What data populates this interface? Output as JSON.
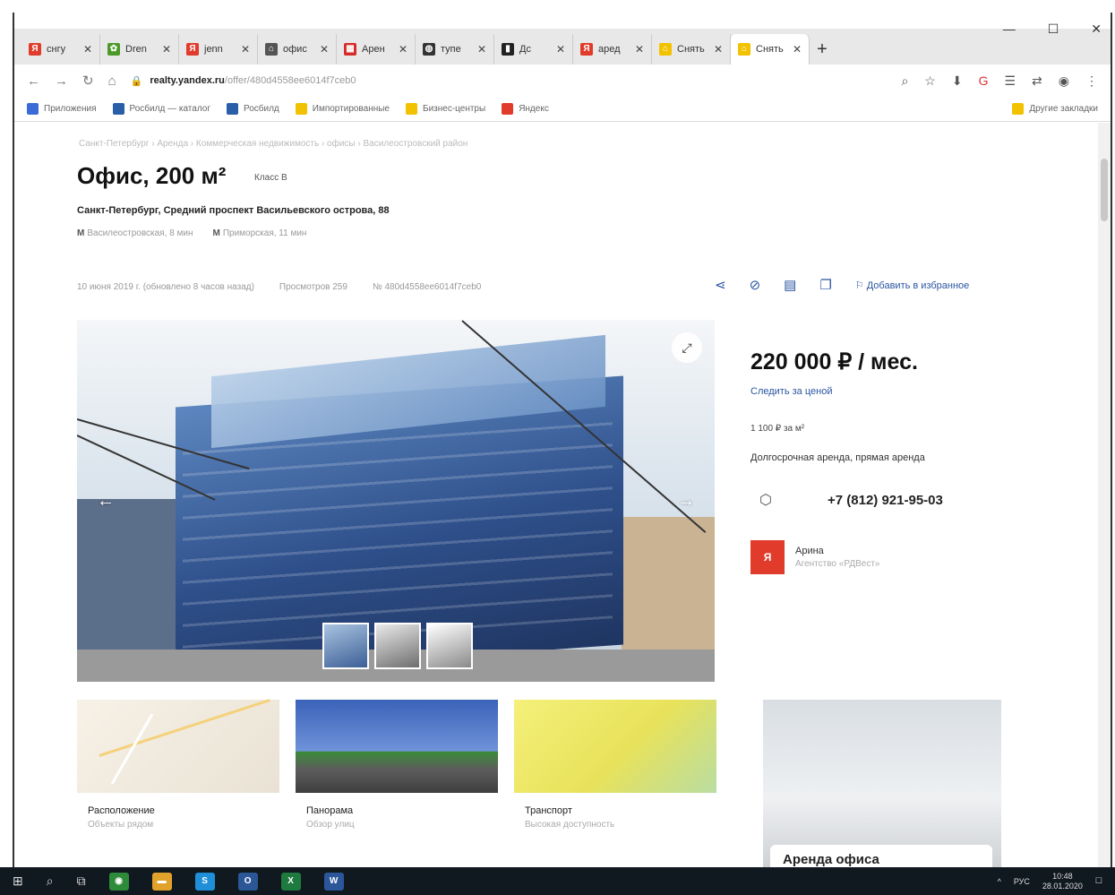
{
  "browser": {
    "tabs": [
      {
        "label": "снгу",
        "color": "#e13b2c",
        "glyph": "Я"
      },
      {
        "label": "Dren",
        "color": "#4c9a2a",
        "glyph": "✿"
      },
      {
        "label": "jenn",
        "color": "#e13b2c",
        "glyph": "Я"
      },
      {
        "label": "офис",
        "color": "#555555",
        "glyph": "⌂"
      },
      {
        "label": "Арен",
        "color": "#d62b2b",
        "glyph": "▦"
      },
      {
        "label": "тупе",
        "color": "#333333",
        "glyph": "◍"
      },
      {
        "label": "Дс",
        "color": "#222222",
        "glyph": "▮"
      },
      {
        "label": "аред",
        "color": "#e13b2c",
        "glyph": "Я"
      },
      {
        "label": "Снять",
        "color": "#f2c200",
        "glyph": "⌂"
      },
      {
        "label": "Снять",
        "color": "#f2c200",
        "glyph": "⌂"
      }
    ],
    "active_tab_index": 9,
    "url_host": "realty.yandex.ru",
    "url_path": "/offer/480d4558ee6014f7ceb0",
    "bookmarks": [
      "Приложения",
      "Росбилд — каталог",
      "Росбилд",
      "Импортированные",
      "Бизнес-центры",
      "Яндекс"
    ],
    "bookmarks_other": "Другие закладки"
  },
  "listing": {
    "breadcrumb": "Санкт-Петербург › Аренда › Коммерческая недвижимость › офисы › Василеостровский район",
    "title": "Офис, 200 м²",
    "class_badge": "Класс B",
    "address": "Санкт-Петербург, Средний проспект Васильевского острова, 88",
    "metro": [
      {
        "station": "Василеостровская, 8 мин",
        "letter": "М"
      },
      {
        "station": "Приморская, 11 мин",
        "letter": "М"
      }
    ],
    "published": "10 июня 2019 г. (обновлено 8 часов назад)",
    "views": "Просмотров 259",
    "offer_id": "№ 480d4558ee6014f7ceb0",
    "add_to_favorites": "Добавить в избранное",
    "price": "220 000 ₽ / мес.",
    "price_follow": "Следить за ценой",
    "price_per_m2": "1 100 ₽ за м²",
    "terms": "Долгосрочная аренда, прямая аренда",
    "phone": "+7 (812) 921-95-03",
    "agent_name": "Арина",
    "agent_org": "Агентство «РДВест»",
    "agent_logo": "Я"
  },
  "cards": [
    {
      "title": "Расположение",
      "subtitle": "Объекты рядом"
    },
    {
      "title": "Панорама",
      "subtitle": "Обзор улиц"
    },
    {
      "title": "Транспорт",
      "subtitle": "Высокая доступность"
    }
  ],
  "ad": {
    "title": "Аренда офиса"
  },
  "taskbar": {
    "lang": "РУС",
    "time": "10:48",
    "date": "28.01.2020"
  }
}
